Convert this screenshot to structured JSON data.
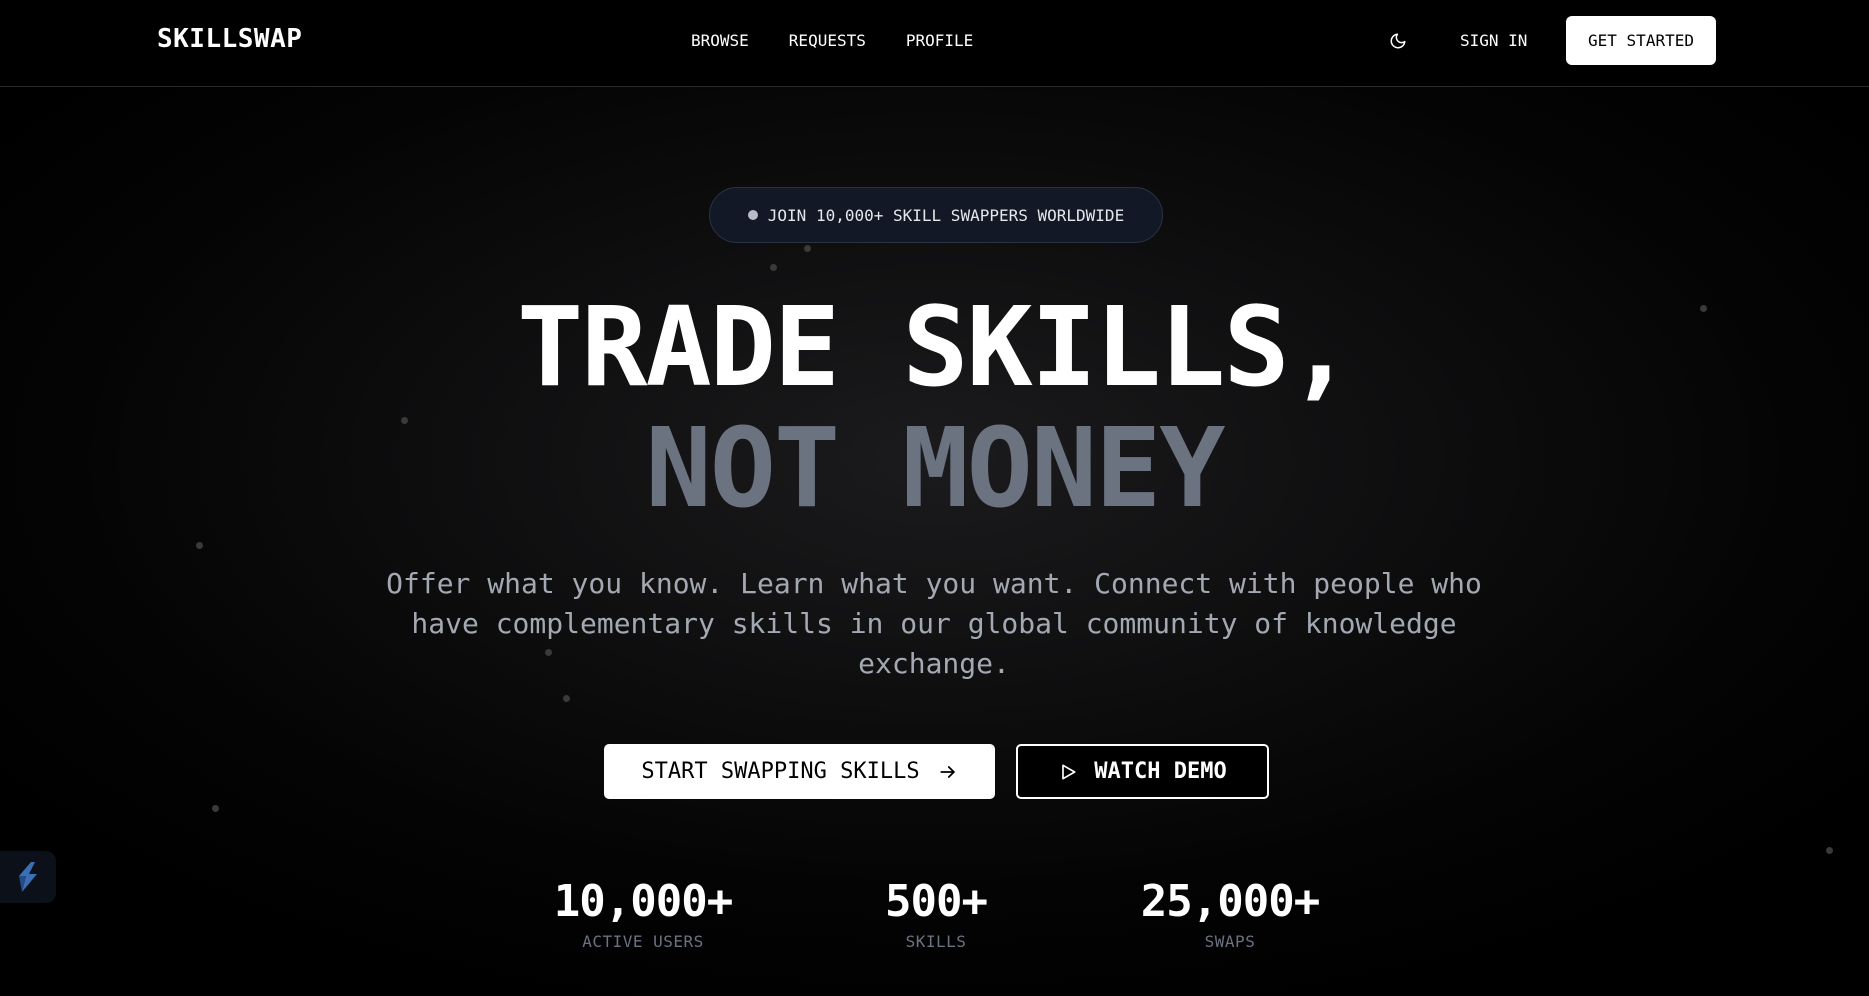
{
  "nav": {
    "logo": "SKILLSWAP",
    "links": [
      {
        "label": "BROWSE"
      },
      {
        "label": "REQUESTS"
      },
      {
        "label": "PROFILE"
      }
    ],
    "theme_icon": "moon-icon",
    "sign_in": "SIGN IN",
    "get_started": "GET STARTED"
  },
  "hero": {
    "badge": "JOIN 10,000+ SKILL SWAPPERS WORLDWIDE",
    "headline_line1": "TRADE SKILLS,",
    "headline_line2": "NOT MONEY",
    "subtitle": "Offer what you know. Learn what you want. Connect with people who have complementary skills in our global community of knowledge exchange.",
    "primary_cta": "START SWAPPING SKILLS",
    "primary_cta_icon": "arrow-right-icon",
    "secondary_cta": "WATCH DEMO",
    "secondary_cta_icon": "play-icon"
  },
  "stats": [
    {
      "value": "10,000+",
      "label": "ACTIVE USERS"
    },
    {
      "value": "500+",
      "label": "SKILLS"
    },
    {
      "value": "25,000+",
      "label": "SWAPS"
    }
  ],
  "side_widget": {
    "icon": "lightning-logo-icon"
  },
  "colors": {
    "background": "#000000",
    "headline_primary": "#ffffff",
    "headline_muted": "#6b7280",
    "subtitle": "#a3a8b2",
    "badge_bg": "#121826"
  }
}
